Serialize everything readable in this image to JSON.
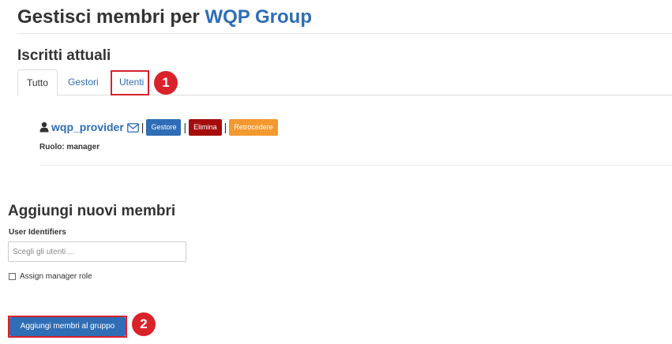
{
  "header": {
    "title_prefix": "Gestisci membri per",
    "group_name": "WQP Group"
  },
  "current_members": {
    "title": "Iscritti attuali",
    "tabs": [
      {
        "label": "Tutto",
        "active": true
      },
      {
        "label": "Gestori",
        "active": false
      },
      {
        "label": "Utenti",
        "active": false
      }
    ],
    "members": [
      {
        "username": "wqp_provider",
        "role_label": "Ruolo: manager",
        "actions": {
          "manager": "Gestore",
          "remove": "Elimina",
          "demote": "Retrocedere"
        }
      }
    ]
  },
  "add_members": {
    "title": "Aggiungi nuovi membri",
    "field_label": "User Identifiers",
    "field_placeholder": "Scegli gli utenti ...",
    "checkbox_label": "Assign manager role",
    "checkbox_checked": false,
    "submit_label": "Aggiungi membri al gruppo"
  },
  "annotations": {
    "callout_1": "1",
    "callout_2": "2",
    "color": "#d9222a"
  },
  "colors": {
    "link": "#2f6db5",
    "danger": "#a50d0d",
    "warning": "#f3992f"
  },
  "icons": {
    "user": "user-icon",
    "mail": "envelope-icon"
  }
}
